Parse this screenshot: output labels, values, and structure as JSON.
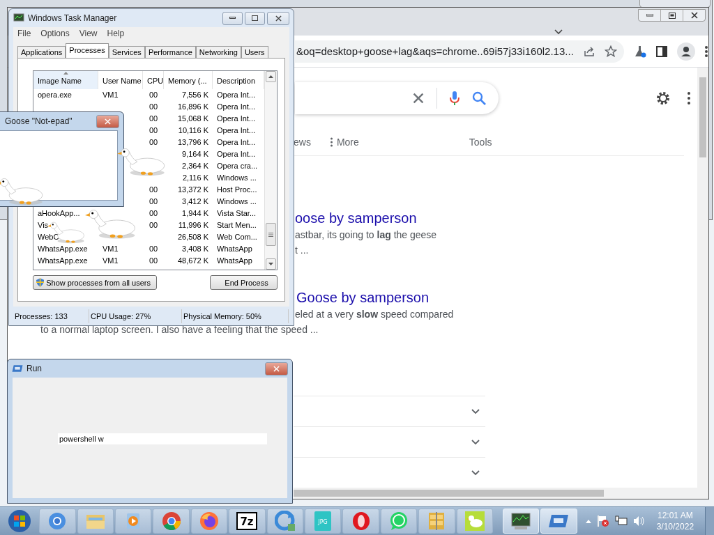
{
  "task_manager": {
    "title": "Windows Task Manager",
    "menu": [
      "File",
      "Options",
      "View",
      "Help"
    ],
    "tabs": [
      {
        "label": "Applications",
        "selected": false
      },
      {
        "label": "Processes",
        "selected": true
      },
      {
        "label": "Services",
        "selected": false
      },
      {
        "label": "Performance",
        "selected": false
      },
      {
        "label": "Networking",
        "selected": false
      },
      {
        "label": "Users",
        "selected": false
      }
    ],
    "columns": [
      {
        "label": "Image Name",
        "sorted": true
      },
      {
        "label": "User Name",
        "sorted": false
      },
      {
        "label": "CPU",
        "sorted": false
      },
      {
        "label": "Memory (...",
        "sorted": false
      },
      {
        "label": "Description",
        "sorted": false
      }
    ],
    "rows": [
      {
        "image_name": "opera.exe",
        "user": "VM1",
        "cpu": "00",
        "memory": "7,556 K",
        "description": "Opera Int..."
      },
      {
        "cpu": "00",
        "memory": "16,896 K",
        "description": "Opera Int..."
      },
      {
        "cpu": "00",
        "memory": "15,068 K",
        "description": "Opera Int..."
      },
      {
        "cpu": "00",
        "memory": "10,116 K",
        "description": "Opera Int..."
      },
      {
        "cpu": "00",
        "memory": "13,796 K",
        "description": "Opera Int..."
      },
      {
        "memory": "9,164 K",
        "description": "Opera Int..."
      },
      {
        "memory": "2,364 K",
        "description": "Opera cra..."
      },
      {
        "memory": "2,116 K",
        "description": "Windows ..."
      },
      {
        "cpu": "00",
        "memory": "13,372 K",
        "description": "Host Proc..."
      },
      {
        "cpu": "00",
        "memory": "3,412 K",
        "description": "Windows ..."
      },
      {
        "image_name": "aHookApp...",
        "cpu": "00",
        "memory": "1,944 K",
        "description": "Vista Star..."
      },
      {
        "image_name": "Vis",
        "cpu": "00",
        "memory": "11,996 K",
        "description": "Start Men..."
      },
      {
        "image_name": "WebC",
        "memory": "26,508 K",
        "description": "Web Com..."
      },
      {
        "image_name": "WhatsApp.exe",
        "user": "VM1",
        "cpu": "00",
        "memory": "3,408 K",
        "description": "WhatsApp"
      },
      {
        "image_name": "WhatsApp.exe",
        "user": "VM1",
        "cpu": "00",
        "memory": "48,672 K",
        "description": "WhatsApp"
      }
    ],
    "buttons": [
      {
        "kind": "shield",
        "label": "Show processes from all users"
      },
      {
        "kind": "plain",
        "label": "End Process"
      }
    ],
    "status": [
      "Processes: 133",
      "CPU Usage: 27%",
      "Physical Memory: 50%"
    ]
  },
  "notepad": {
    "title": "Goose \"Not-epad\""
  },
  "browser": {
    "url": "&oq=desktop+goose+lag&aqs=chrome..69i57j33i160l2.13...",
    "nav": [
      "ews",
      "More"
    ],
    "tools": "Tools",
    "results": [
      {
        "title": "oose by samperson",
        "lines": [
          {
            "text": "astbar, its going to **lag** the geese",
            "kind": "clipped"
          },
          {
            "text": "t ...",
            "kind": "clipped"
          }
        ]
      },
      {
        "title": "Goose by samperson",
        "lines": [
          {
            "text": "eled at a very **slow** speed compared",
            "kind": "clipped"
          },
          {
            "text": "to a normal laptop screen. I also have a feeling that the speed ...",
            "kind": "full"
          }
        ]
      }
    ],
    "questions": [
      {
        "expanded": false
      },
      {
        "expanded": false
      },
      {
        "expanded": false
      }
    ]
  },
  "run": {
    "title": "Run",
    "value": "powershell w"
  },
  "taskbar": {
    "apps": [
      {
        "kind": "chromium",
        "running": false
      },
      {
        "kind": "folder",
        "running": false
      },
      {
        "kind": "media",
        "running": false
      },
      {
        "kind": "chrome",
        "running": false
      },
      {
        "kind": "firefox",
        "running": false
      },
      {
        "kind": "sevenzip",
        "label": "7z",
        "running": false
      },
      {
        "kind": "sync",
        "running": false
      },
      {
        "kind": "jpg",
        "label": "JPG",
        "running": false
      },
      {
        "kind": "opera",
        "running": false
      },
      {
        "kind": "whatsapp",
        "running": false
      },
      {
        "kind": "archive",
        "running": false
      },
      {
        "kind": "goose",
        "running": false
      },
      {
        "kind": "monitor",
        "running": true
      },
      {
        "kind": "run",
        "running": true
      }
    ],
    "time": "12:01 AM",
    "date": "3/10/2022"
  }
}
